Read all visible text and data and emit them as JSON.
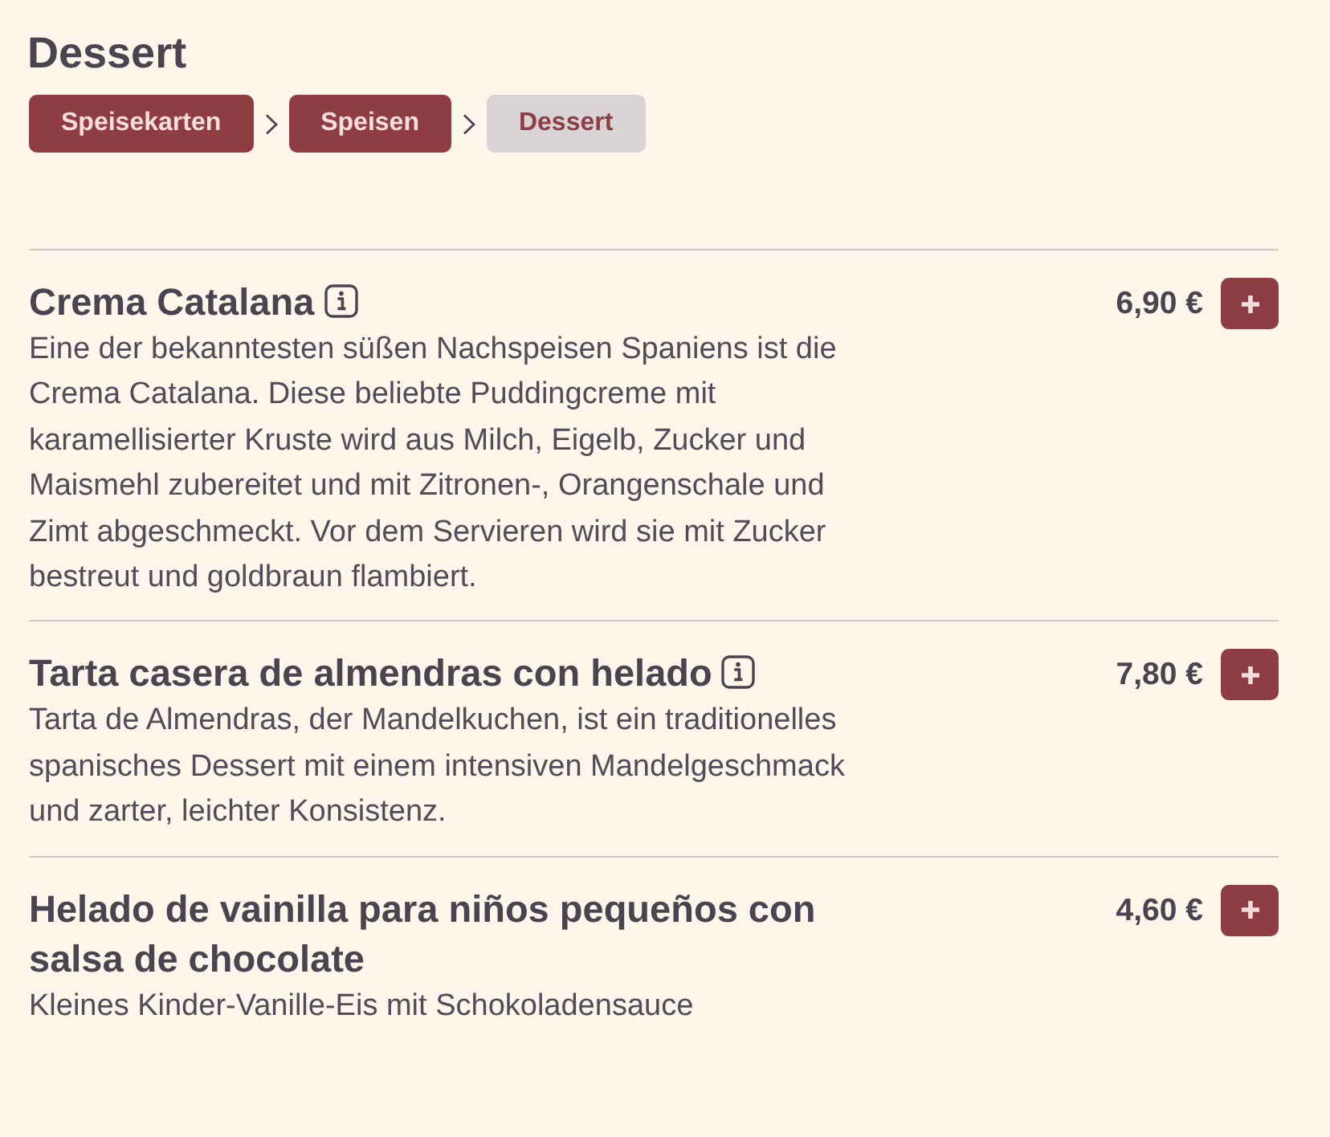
{
  "page": {
    "title": "Dessert"
  },
  "breadcrumbs": [
    {
      "label": "Speisekarten",
      "selected": false
    },
    {
      "label": "Speisen",
      "selected": false
    },
    {
      "label": "Dessert",
      "selected": true
    }
  ],
  "items": [
    {
      "name": "Crema Catalana",
      "info": true,
      "description": "Eine der bekanntesten süßen Nachspeisen Spaniens ist die Crema Catalana. Diese beliebte Puddingcreme mit karamellisierter Kruste wird aus Milch, Eigelb, Zucker und Maismehl zubereitet und mit Zitronen-, Orangenschale und Zimt abgeschmeckt. Vor dem Servieren wird sie mit Zucker bestreut und goldbraun flambiert.",
      "price": "6,90 €"
    },
    {
      "name": "Tarta casera de almendras con helado",
      "info": true,
      "description": "Tarta de Almendras, der Mandelkuchen, ist ein traditionelles spanisches Dessert mit einem intensiven Mandelgeschmack und zarter, leichter Konsistenz.",
      "price": "7,80 €"
    },
    {
      "name": "Helado de vainilla para niños pequeños con salsa de chocolate",
      "info": false,
      "description": "Kleines Kinder-Vanille-Eis mit Schokoladensauce",
      "price": "4,60 €"
    }
  ]
}
